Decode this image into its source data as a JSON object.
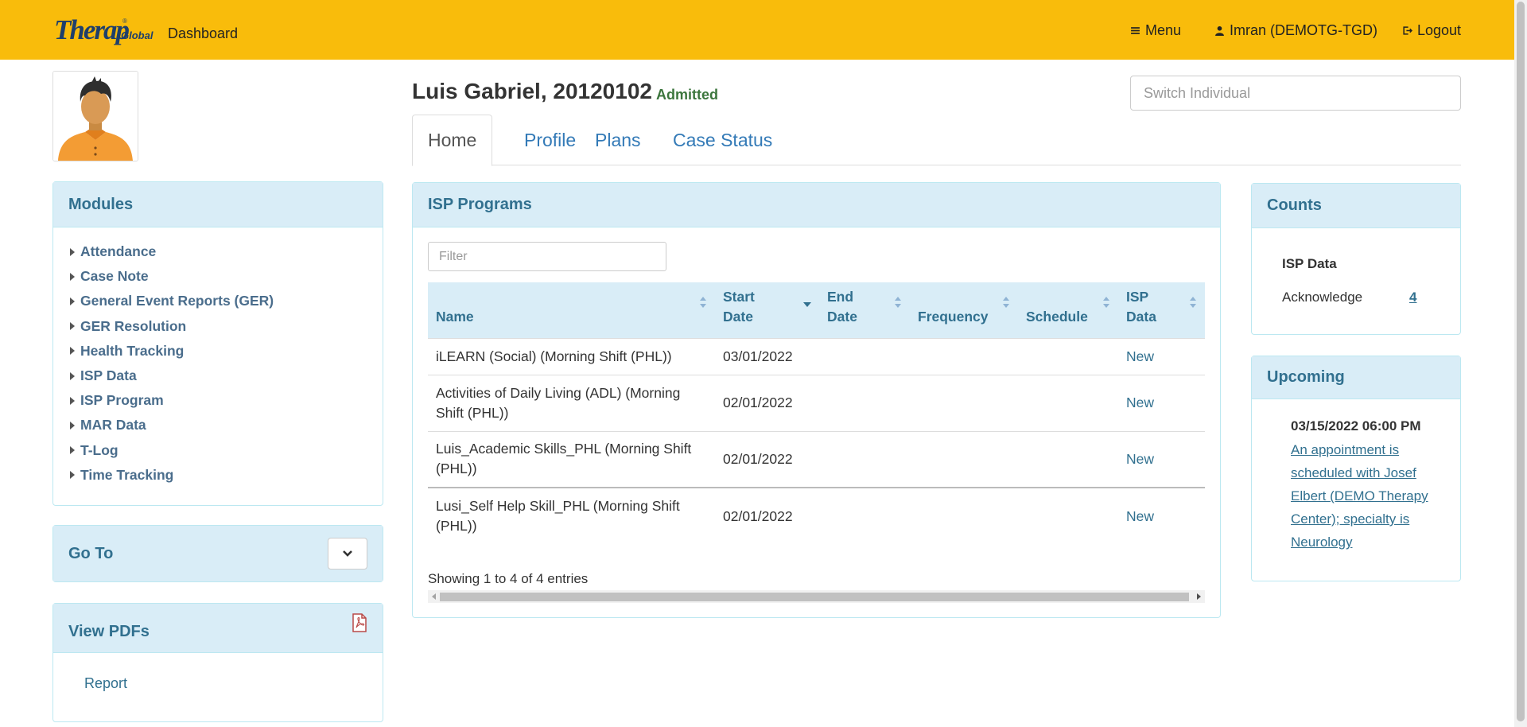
{
  "header": {
    "logo_text": "Therap",
    "logo_sub": "Global",
    "dashboard_label": "Dashboard",
    "menu_label": "Menu",
    "user_label": "Imran (DEMOTG-TGD)",
    "logout_label": "Logout"
  },
  "colors": {
    "header_bg": "#f9bc0b",
    "panel_head_bg": "#d9edf7",
    "panel_head_text": "#31708f",
    "status_green": "#3c763d"
  },
  "individual": {
    "name": "Luis Gabriel, 20120102",
    "status": "Admitted",
    "switch_placeholder": "Switch Individual"
  },
  "tabs": [
    {
      "label": "Home",
      "active": true
    },
    {
      "label": "Profile",
      "active": false
    },
    {
      "label": "Plans",
      "active": false
    },
    {
      "label": "Case Status",
      "active": false
    }
  ],
  "sidebar": {
    "modules_title": "Modules",
    "modules": [
      {
        "label": "Attendance"
      },
      {
        "label": "Case Note"
      },
      {
        "label": "General Event Reports (GER)"
      },
      {
        "label": "GER Resolution"
      },
      {
        "label": "Health Tracking"
      },
      {
        "label": "ISP Data"
      },
      {
        "label": "ISP Program"
      },
      {
        "label": "MAR Data"
      },
      {
        "label": "T-Log"
      },
      {
        "label": "Time Tracking"
      }
    ],
    "goto_title": "Go To",
    "pdfs_title": "View PDFs",
    "report_label": "Report"
  },
  "isp_programs": {
    "title": "ISP Programs",
    "filter_placeholder": "Filter",
    "columns": {
      "name": "Name",
      "start_date_1": "Start",
      "start_date_2": "Date",
      "end_date_1": "End",
      "end_date_2": "Date",
      "frequency": "Frequency",
      "schedule": "Schedule",
      "isp_data_1": "ISP",
      "isp_data_2": "Data"
    },
    "rows": [
      {
        "name": "iLEARN (Social) (Morning Shift (PHL))",
        "start_date": "03/01/2022",
        "end_date": "",
        "frequency": "",
        "schedule": "",
        "isp_data": "New"
      },
      {
        "name": "Activities of Daily Living (ADL) (Morning Shift (PHL))",
        "start_date": "02/01/2022",
        "end_date": "",
        "frequency": "",
        "schedule": "",
        "isp_data": "New"
      },
      {
        "name": "Luis_Academic Skills_PHL (Morning Shift (PHL))",
        "start_date": "02/01/2022",
        "end_date": "",
        "frequency": "",
        "schedule": "",
        "isp_data": "New"
      },
      {
        "name": "Lusi_Self Help Skill_PHL (Morning Shift (PHL))",
        "start_date": "02/01/2022",
        "end_date": "",
        "frequency": "",
        "schedule": "",
        "isp_data": "New"
      }
    ],
    "info": "Showing 1 to 4 of 4 entries"
  },
  "counts": {
    "title": "Counts",
    "section": "ISP Data",
    "label": "Acknowledge",
    "value": "4"
  },
  "upcoming": {
    "title": "Upcoming",
    "date": "03/15/2022 06:00 PM",
    "text": "An appointment is scheduled with Josef Elbert (DEMO Therapy Center); specialty is Neurology"
  },
  "icons": {
    "menu": "hamburger-icon",
    "user": "user-icon",
    "logout": "logout-icon",
    "goto": "chevron-down-icon",
    "pdf": "pdf-icon",
    "sort": "sort-icon"
  }
}
